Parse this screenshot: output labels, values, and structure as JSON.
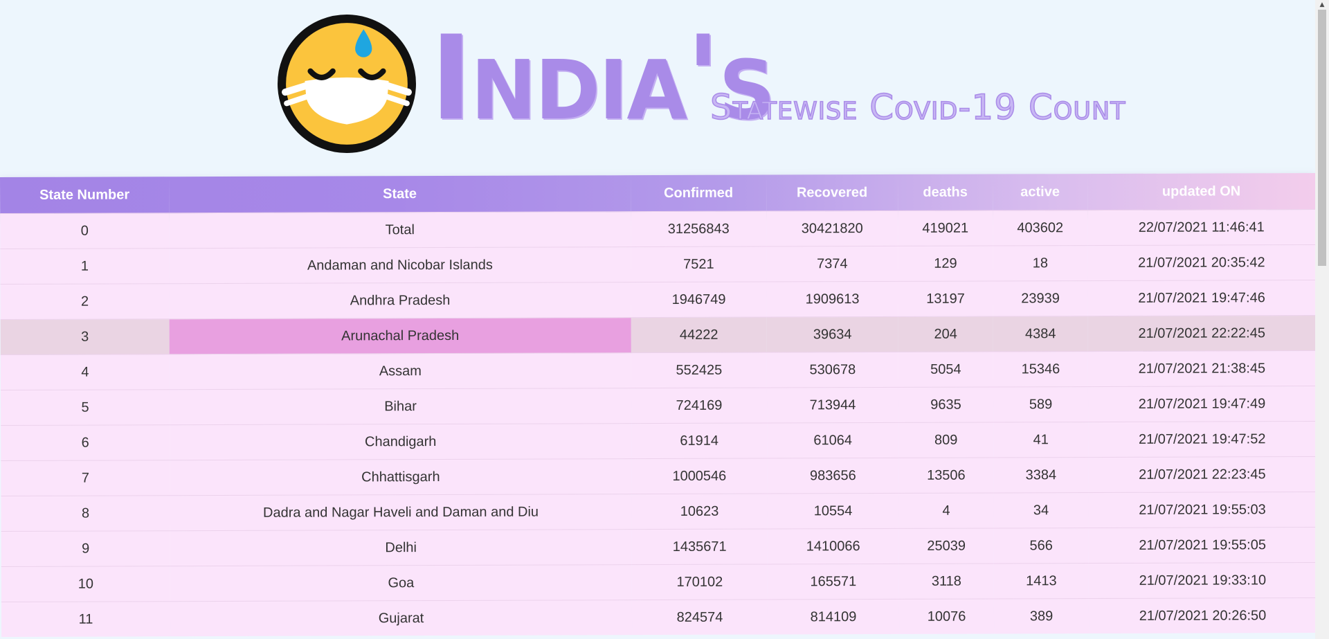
{
  "header": {
    "title_main": "India's",
    "title_sub": "Statewise Covid-19 Count",
    "logo_icon": "masked-sweating-face-icon"
  },
  "colors": {
    "title": "#a98be8",
    "header_gradient_start": "#a384e6",
    "header_gradient_end": "#f3cdec",
    "row_bg": "#fbe4fb",
    "row_hover_bg": "#ead4e3",
    "cell_hover_bg": "#e8a0e0",
    "page_bg": "#edf6fd"
  },
  "table": {
    "columns": [
      "State Number",
      "State",
      "Confirmed",
      "Recovered",
      "deaths",
      "active",
      "updated ON"
    ],
    "rows": [
      [
        "0",
        "Total",
        "31256843",
        "30421820",
        "419021",
        "403602",
        "22/07/2021 11:46:41"
      ],
      [
        "1",
        "Andaman and Nicobar Islands",
        "7521",
        "7374",
        "129",
        "18",
        "21/07/2021 20:35:42"
      ],
      [
        "2",
        "Andhra Pradesh",
        "1946749",
        "1909613",
        "13197",
        "23939",
        "21/07/2021 19:47:46"
      ],
      [
        "3",
        "Arunachal Pradesh",
        "44222",
        "39634",
        "204",
        "4384",
        "21/07/2021 22:22:45"
      ],
      [
        "4",
        "Assam",
        "552425",
        "530678",
        "5054",
        "15346",
        "21/07/2021 21:38:45"
      ],
      [
        "5",
        "Bihar",
        "724169",
        "713944",
        "9635",
        "589",
        "21/07/2021 19:47:49"
      ],
      [
        "6",
        "Chandigarh",
        "61914",
        "61064",
        "809",
        "41",
        "21/07/2021 19:47:52"
      ],
      [
        "7",
        "Chhattisgarh",
        "1000546",
        "983656",
        "13506",
        "3384",
        "21/07/2021 22:23:45"
      ],
      [
        "8",
        "Dadra and Nagar Haveli and Daman and Diu",
        "10623",
        "10554",
        "4",
        "34",
        "21/07/2021 19:55:03"
      ],
      [
        "9",
        "Delhi",
        "1435671",
        "1410066",
        "25039",
        "566",
        "21/07/2021 19:55:05"
      ],
      [
        "10",
        "Goa",
        "170102",
        "165571",
        "3118",
        "1413",
        "21/07/2021 19:33:10"
      ],
      [
        "11",
        "Gujarat",
        "824574",
        "814109",
        "10076",
        "389",
        "21/07/2021 20:26:50"
      ]
    ]
  }
}
